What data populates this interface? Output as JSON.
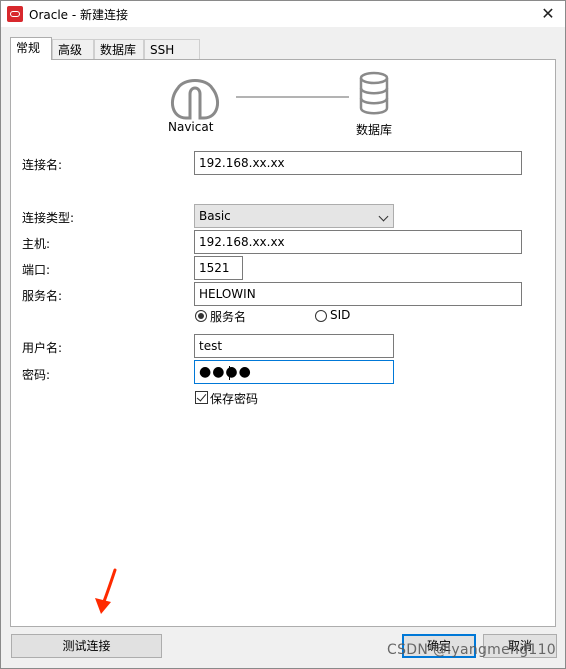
{
  "window": {
    "title": "Oracle - 新建连接",
    "close_glyph": "✕"
  },
  "tabs": [
    {
      "label": "常规",
      "active": true
    },
    {
      "label": "高级",
      "active": false
    },
    {
      "label": "数据库",
      "active": false
    },
    {
      "label": "SSH",
      "active": false
    }
  ],
  "diagram": {
    "left_label": "Navicat",
    "right_label": "数据库"
  },
  "form": {
    "connection_name_label": "连接名:",
    "connection_name_value": "192.168.xx.xx",
    "connection_type_label": "连接类型:",
    "connection_type_value": "Basic",
    "host_label": "主机:",
    "host_value": "192.168.xx.xx",
    "port_label": "端口:",
    "port_value": "1521",
    "service_label": "服务名:",
    "service_value": "HELOWIN",
    "radio_service_label": "服务名",
    "radio_sid_label": "SID",
    "username_label": "用户名:",
    "username_value": "test",
    "password_label": "密码:",
    "password_value": "●●●●",
    "save_password_label": "保存密码"
  },
  "buttons": {
    "test": "测试连接",
    "ok": "确定",
    "cancel": "取消"
  },
  "watermark": "CSDN @lyangmeng110",
  "colors": {
    "accent": "#0078d7",
    "annotation_arrow": "#ff2a00",
    "oracle_icon": "#d8282d"
  }
}
